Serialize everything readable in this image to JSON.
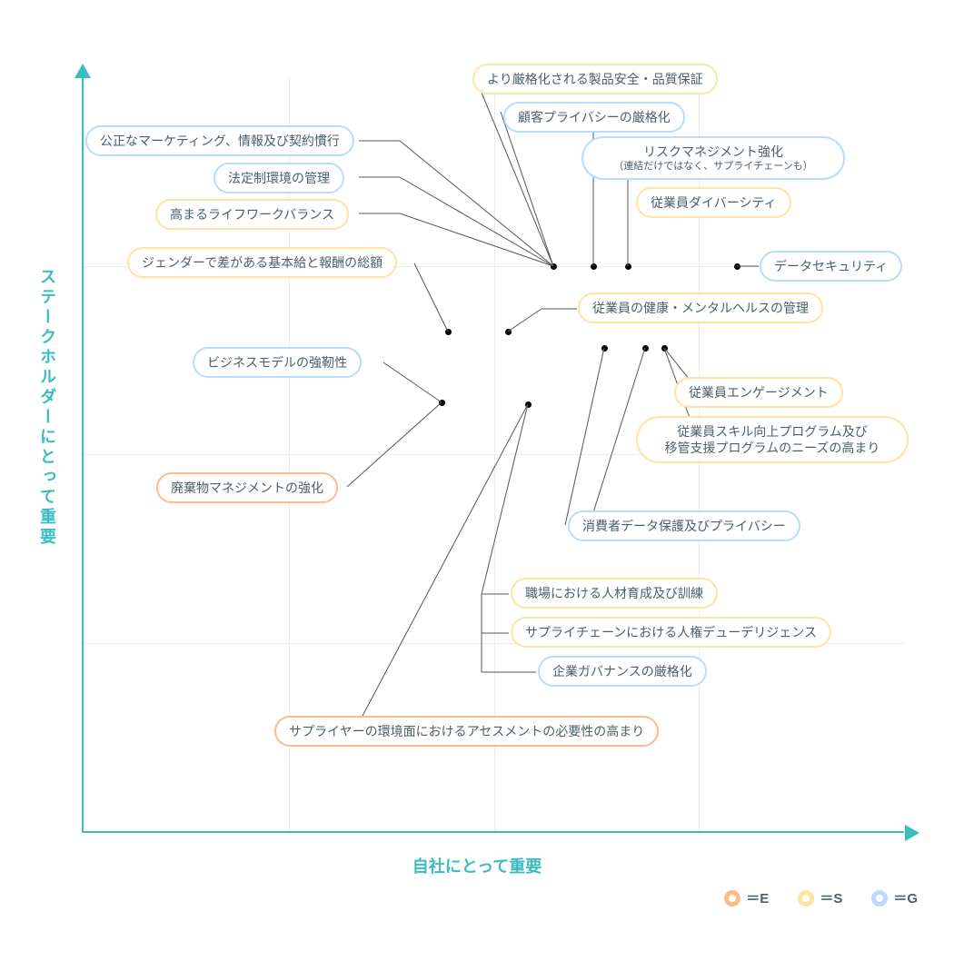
{
  "axes": {
    "x_label": "自社にとって重要",
    "y_label": "ステークホルダーにとって重要"
  },
  "legend": {
    "e": "＝E",
    "s": "＝S",
    "g": "＝G"
  },
  "pills": {
    "p1": "より厳格化される製品安全・品質保証",
    "p2": "顧客プライバシーの厳格化",
    "p3": "公正なマーケティング、情報及び契約慣行",
    "p4": "法定制環境の管理",
    "p5": "高まるライフワークバランス",
    "p6a": "リスクマネジメント強化",
    "p6b": "（連結だけではなく、サプライチェーンも）",
    "p7": "従業員ダイバーシティ",
    "p8": "ジェンダーで差がある基本給と報酬の総額",
    "p9": "データセキュリティ",
    "p10": "従業員の健康・メンタルヘルスの管理",
    "p11": "ビジネスモデルの強靭性",
    "p12": "従業員エンゲージメント",
    "p13a": "従業員スキル向上プログラム及び",
    "p13b": "移管支援プログラムのニーズの高まり",
    "p14": "廃棄物マネジメントの強化",
    "p15": "消費者データ保護及びプライバシー",
    "p16": "職場における人材育成及び訓練",
    "p17": "サプライチェーンにおける人権デューデリジェンス",
    "p18": "企業ガバナンスの厳格化",
    "p19": "サプライヤーの環境面におけるアセスメントの必要性の高まり"
  },
  "chart_data": {
    "type": "scatter",
    "xlabel": "自社にとって重要",
    "ylabel": "ステークホルダーにとって重要",
    "xlim": [
      0,
      4
    ],
    "ylim": [
      0,
      4
    ],
    "grid": true,
    "categories": {
      "E": "Environment",
      "S": "Social",
      "G": "Governance"
    },
    "legend_position": "bottom-right",
    "points": [
      {
        "label": "より厳格化される製品安全・品質保証",
        "category": "S",
        "x": 2.45,
        "y": 3.15
      },
      {
        "label": "顧客プライバシーの厳格化",
        "category": "G",
        "x": 2.65,
        "y": 3.15
      },
      {
        "label": "公正なマーケティング、情報及び契約慣行",
        "category": "G",
        "x": 2.45,
        "y": 3.15
      },
      {
        "label": "法定制環境の管理",
        "category": "G",
        "x": 2.45,
        "y": 3.15
      },
      {
        "label": "高まるライフワークバランス",
        "category": "S",
        "x": 2.45,
        "y": 3.15
      },
      {
        "label": "リスクマネジメント強化（連結だけではなく、サプライチェーンも）",
        "category": "G",
        "x": 2.8,
        "y": 3.15
      },
      {
        "label": "従業員ダイバーシティ",
        "category": "S",
        "x": 2.8,
        "y": 3.15
      },
      {
        "label": "ジェンダーで差がある基本給と報酬の総額",
        "category": "S",
        "x": 2.15,
        "y": 2.7
      },
      {
        "label": "データセキュリティ",
        "category": "G",
        "x": 3.4,
        "y": 3.15
      },
      {
        "label": "従業員の健康・メンタルヘルスの管理",
        "category": "S",
        "x": 2.95,
        "y": 2.7
      },
      {
        "label": "ビジネスモデルの強靭性",
        "category": "G",
        "x": 1.9,
        "y": 2.2
      },
      {
        "label": "従業員エンゲージメント",
        "category": "S",
        "x": 3.1,
        "y": 2.7
      },
      {
        "label": "従業員スキル向上プログラム及び移管支援プログラムのニーズの高まり",
        "category": "S",
        "x": 3.1,
        "y": 2.7
      },
      {
        "label": "廃棄物マネジメントの強化",
        "category": "E",
        "x": 2.3,
        "y": 2.7
      },
      {
        "label": "消費者データ保護及びプライバシー",
        "category": "G",
        "x": 2.8,
        "y": 2.7
      },
      {
        "label": "職場における人材育成及び訓練",
        "category": "S",
        "x": 2.35,
        "y": 2.4
      },
      {
        "label": "サプライチェーンにおける人権デューデリジェンス",
        "category": "S",
        "x": 2.35,
        "y": 2.4
      },
      {
        "label": "企業ガバナンスの厳格化",
        "category": "G",
        "x": 2.35,
        "y": 2.4
      },
      {
        "label": "サプライヤーの環境面におけるアセスメントの必要性の高まり",
        "category": "E",
        "x": 2.65,
        "y": 2.7
      }
    ]
  }
}
